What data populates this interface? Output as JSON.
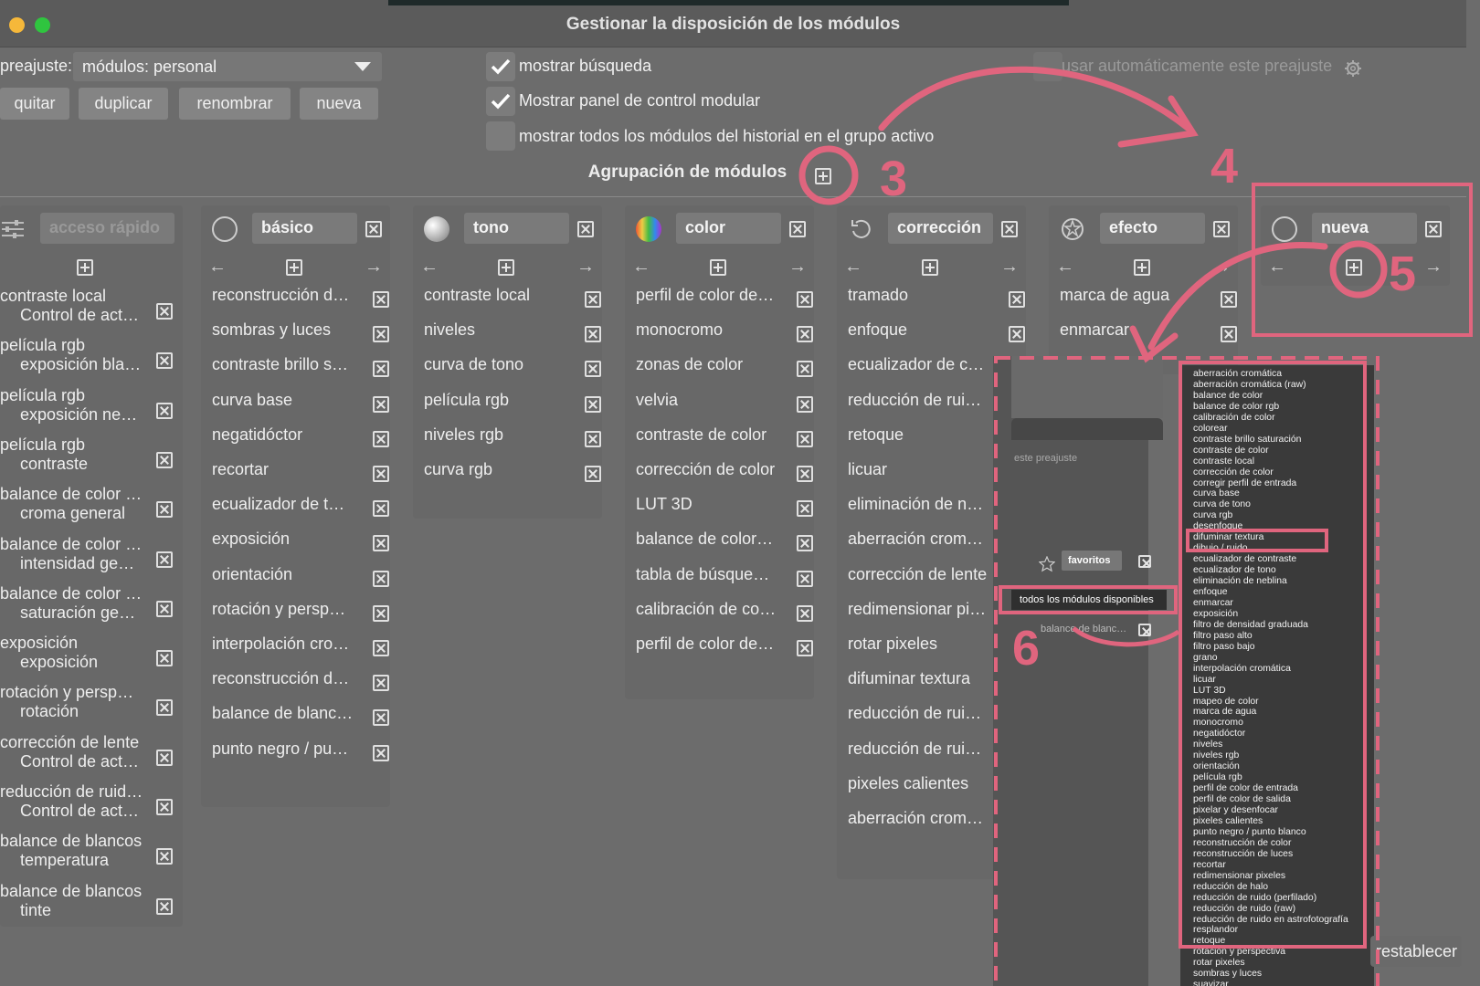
{
  "window": {
    "title": "Gestionar la disposición de los módulos"
  },
  "preset": {
    "label": "preajuste:",
    "value": "módulos: personal",
    "buttons": [
      "quitar",
      "duplicar",
      "renombrar",
      "nueva"
    ],
    "auto_apply": "usar automáticamente este preajuste"
  },
  "options": {
    "show_search": "mostrar búsqueda",
    "show_modular_panel": "Mostrar panel de control modular",
    "show_all_history": "mostrar todos los módulos del historial en el grupo activo"
  },
  "grouping_title": "Agrupación de módulos",
  "quick_access": {
    "placeholder": "acceso rápido",
    "items": [
      [
        "contraste local",
        "Control de act…"
      ],
      [
        "película rgb",
        "exposición bla…"
      ],
      [
        "película rgb",
        "exposición ne…"
      ],
      [
        "película rgb",
        "contraste"
      ],
      [
        "balance de color …",
        "croma general"
      ],
      [
        "balance de color …",
        "intensidad ge…"
      ],
      [
        "balance de color …",
        "saturación ge…"
      ],
      [
        "exposición",
        "exposición"
      ],
      [
        "rotación y persp…",
        "rotación"
      ],
      [
        "corrección de lente",
        "Control de act…"
      ],
      [
        "reducción de ruid…",
        "Control de act…"
      ],
      [
        "balance de blancos",
        "temperatura"
      ],
      [
        "balance de blancos",
        "tinte"
      ]
    ]
  },
  "groups": [
    {
      "name": "básico",
      "items": [
        "reconstrucción d…",
        "sombras y luces",
        "contraste brillo s…",
        "curva base",
        "negatidóctor",
        "recortar",
        "ecualizador de t…",
        "exposición",
        "orientación",
        "rotación y persp…",
        "interpolación cro…",
        "reconstrucción d…",
        "balance de blanc…",
        "punto negro / pu…"
      ]
    },
    {
      "name": "tono",
      "items": [
        "contraste local",
        "niveles",
        "curva de tono",
        "película rgb",
        "niveles rgb",
        "curva rgb"
      ]
    },
    {
      "name": "color",
      "items": [
        "perfil de color de…",
        "monocromo",
        "zonas de color",
        "velvia",
        "contraste de color",
        "corrección de color",
        "LUT 3D",
        "balance de color…",
        "tabla de búsque…",
        "calibración de co…",
        "perfil de color de…"
      ]
    },
    {
      "name": "corrección",
      "items": [
        "tramado",
        "enfoque",
        "ecualizador de c…",
        "reducción de rui…",
        "retoque",
        "licuar",
        "eliminación de n…",
        "aberración crom…",
        "corrección de lente",
        "redimensionar pi…",
        "rotar pixeles",
        "difuminar textura",
        "reducción de rui…",
        "reducción de rui…",
        "pixeles calientes",
        "aberración crom…"
      ]
    },
    {
      "name": "efecto",
      "items": [
        "marca de agua",
        "enmarcar"
      ]
    },
    {
      "name": "nueva",
      "items": []
    }
  ],
  "inset": {
    "preset_label": "este preajuste",
    "group_name": "favoritos",
    "all_modules": "todos los módulos disponibles",
    "item": "balance de blanc…"
  },
  "module_list": [
    "aberración cromática",
    "aberración cromática (raw)",
    "balance de color",
    "balance de color rgb",
    "calibración de color",
    "colorear",
    "contraste brillo saturación",
    "contraste de color",
    "contraste local",
    "corrección de color",
    "corregir perfil de entrada",
    "curva base",
    "curva de tono",
    "curva rgb",
    "desenfoque",
    "difuminar textura",
    "dibujo / ruido",
    "ecualizador de contraste",
    "ecualizador de tono",
    "eliminación de neblina",
    "enfoque",
    "enmarcar",
    "exposición",
    "filtro de densidad graduada",
    "filtro paso alto",
    "filtro paso bajo",
    "grano",
    "interpolación cromática",
    "licuar",
    "LUT 3D",
    "mapeo de color",
    "marca de agua",
    "monocromo",
    "negatidóctor",
    "niveles",
    "niveles rgb",
    "orientación",
    "película rgb",
    "perfil de color de entrada",
    "perfil de color de salida",
    "pixelar y desenfocar",
    "pixeles calientes",
    "punto negro / punto blanco",
    "reconstrucción de color",
    "reconstrucción de luces",
    "recortar",
    "redimensionar pixeles",
    "reducción de halo",
    "reducción de ruido (perfilado)",
    "reducción de ruido (raw)",
    "reducción de ruido en astrofotografía",
    "resplandor",
    "retoque",
    "rotación y perspectiva",
    "rotar pixeles",
    "sombras y luces",
    "suavizar"
  ],
  "reset_button": "restablecer",
  "annotations": [
    "3",
    "4",
    "5",
    "6"
  ],
  "colors": {
    "annotation": "#e0657e",
    "background": "#6c6c6c"
  }
}
